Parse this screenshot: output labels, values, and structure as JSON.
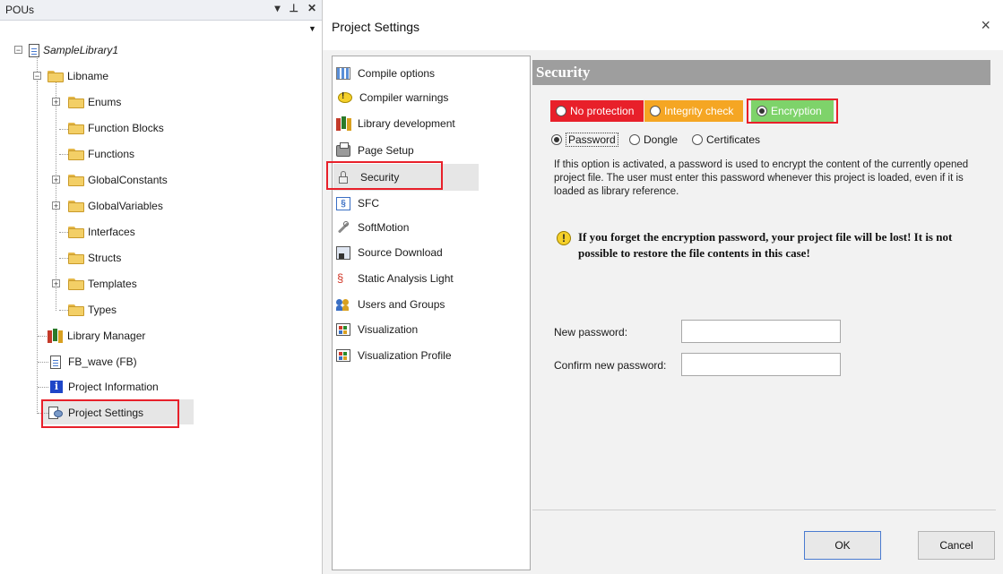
{
  "pous_panel": {
    "title": "POUs",
    "controls": {
      "dropdown": "▾",
      "pin": "⊥",
      "close": "✕"
    },
    "scroll_arrow": "▼",
    "tree": [
      {
        "label": "SampleLibrary1",
        "icon": "library-file-icon",
        "expander": "−"
      },
      {
        "label": "Libname",
        "icon": "folder-icon",
        "expander": "−"
      },
      {
        "label": "Enums",
        "icon": "folder-icon",
        "expander": "+"
      },
      {
        "label": "Function Blocks",
        "icon": "folder-icon"
      },
      {
        "label": "Functions",
        "icon": "folder-icon"
      },
      {
        "label": "GlobalConstants",
        "icon": "folder-icon",
        "expander": "+"
      },
      {
        "label": "GlobalVariables",
        "icon": "folder-icon",
        "expander": "+"
      },
      {
        "label": "Interfaces",
        "icon": "folder-icon"
      },
      {
        "label": "Structs",
        "icon": "folder-icon"
      },
      {
        "label": "Templates",
        "icon": "folder-icon",
        "expander": "+"
      },
      {
        "label": "Types",
        "icon": "folder-icon"
      },
      {
        "label": "Library Manager",
        "icon": "books-icon"
      },
      {
        "label": "FB_wave (FB)",
        "icon": "document-icon"
      },
      {
        "label": "Project Information",
        "icon": "info-icon"
      },
      {
        "label": "Project Settings",
        "icon": "settings-document-icon"
      }
    ]
  },
  "dialog": {
    "title": "Project Settings",
    "close": "×",
    "categories": [
      {
        "label": "Compile options",
        "icon": "compile-options-icon"
      },
      {
        "label": "Compiler warnings",
        "icon": "warning-icon"
      },
      {
        "label": "Library development",
        "icon": "books-icon"
      },
      {
        "label": "Page Setup",
        "icon": "printer-icon"
      },
      {
        "label": "Security",
        "icon": "lock-icon"
      },
      {
        "label": "SFC",
        "icon": "sfc-icon"
      },
      {
        "label": "SoftMotion",
        "icon": "softmotion-icon"
      },
      {
        "label": "Source Download",
        "icon": "source-download-icon"
      },
      {
        "label": "Static Analysis Light",
        "icon": "static-analysis-icon"
      },
      {
        "label": "Users and Groups",
        "icon": "users-icon"
      },
      {
        "label": "Visualization",
        "icon": "visualization-icon"
      },
      {
        "label": "Visualization Profile",
        "icon": "visualization-profile-icon"
      }
    ],
    "selected_category": "Security",
    "security": {
      "header": "Security",
      "protection_options": [
        {
          "label": "No protection",
          "color": "#e8202a",
          "text_color": "#ffffff",
          "selected": false
        },
        {
          "label": "Integrity check",
          "color": "#f5a623",
          "text_color": "#ffffff",
          "selected": false
        },
        {
          "label": "Encryption",
          "color": "#7ed36a",
          "text_color": "#ffffff",
          "selected": true
        }
      ],
      "auth_options": [
        {
          "label": "Password",
          "selected": true
        },
        {
          "label": "Dongle",
          "selected": false
        },
        {
          "label": "Certificates",
          "selected": false
        }
      ],
      "description": "If this option is activated, a password is used to encrypt the content of the currently opened project file. The user must enter this password whenever this project is loaded, even if it is loaded as library reference.",
      "warning": "If you forget the encryption password, your project file will be lost! It is not possible to restore the file contents in this case!",
      "new_password_label": "New password:",
      "new_password_value": "",
      "confirm_password_label": "Confirm new password:",
      "confirm_password_value": ""
    },
    "buttons": {
      "ok": "OK",
      "cancel": "Cancel"
    }
  },
  "colors": {
    "highlight_box": "#e8202a",
    "section_header_bg": "#9e9e9e",
    "selection_bg": "#e6e6e6"
  }
}
